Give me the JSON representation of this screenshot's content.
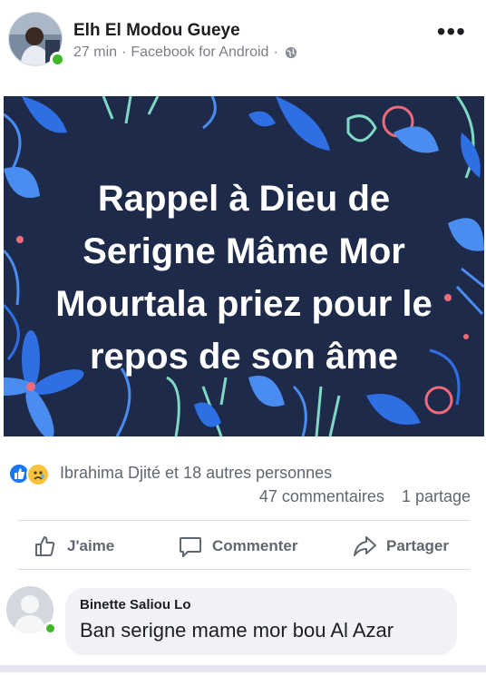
{
  "post": {
    "author": "Elh El Modou Gueye",
    "time": "27 min",
    "separator": "·",
    "source": "Facebook for Android",
    "separator2": "·",
    "more": "•••"
  },
  "banner": {
    "text": "Rappel à Dieu de Serigne Mâme Mor Mourtala priez pour le repos de son âme",
    "colors": {
      "background": "#1e2a4a",
      "leaf_blue": "#2f6fe4",
      "leaf_light": "#4a8df0",
      "pink": "#f06a7a",
      "mint": "#7fd9c4"
    }
  },
  "reactions": {
    "summary": "Ibrahima Djité et 18 autres personnes",
    "comments": "47 commentaires",
    "shares": "1 partage",
    "icons": [
      "like-icon",
      "sad-icon"
    ]
  },
  "actions": {
    "like": "J'aime",
    "comment": "Commenter",
    "share": "Partager"
  },
  "comment": {
    "author": "Binette Saliou Lo",
    "text": "Ban serigne mame mor bou Al Azar"
  }
}
